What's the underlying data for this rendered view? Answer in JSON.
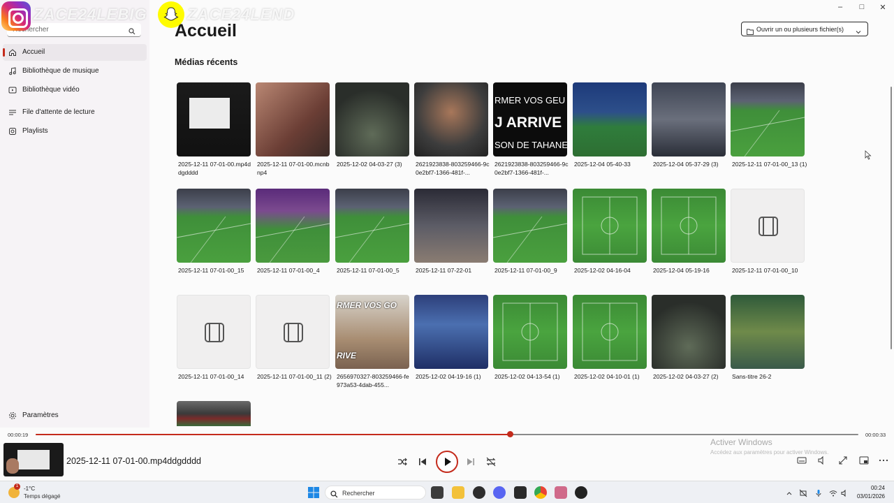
{
  "overlay": {
    "instagram_handle": "ZACE24LEBIG",
    "snapchat_handle": "ZACE24LEND"
  },
  "sidebar": {
    "search_placeholder": "Rechercher",
    "items": [
      {
        "label": "Accueil",
        "icon": "home-icon",
        "active": true
      },
      {
        "label": "Bibliothèque de musique",
        "icon": "music-note-icon"
      },
      {
        "label": "Bibliothèque vidéo",
        "icon": "video-icon"
      },
      {
        "label": "File d'attente de lecture",
        "icon": "queue-icon"
      },
      {
        "label": "Playlists",
        "icon": "playlist-icon"
      }
    ],
    "settings_label": "Paramètres"
  },
  "header": {
    "title": "Accueil",
    "open_button_label": "Ouvrir un ou plusieurs fichier(s)"
  },
  "recent": {
    "title": "Médias récents",
    "items": [
      {
        "caption": "2025-12-11 07-01-00.mp4ddgdddd",
        "thumb": "screen"
      },
      {
        "caption": "2025-12-11 07-01-00.mcnbnp4",
        "thumb": "faces"
      },
      {
        "caption": "2025-12-02 04-03-27 (3)",
        "thumb": "dark"
      },
      {
        "caption": "2621923838-803259466-9c0e2bf7-1366-481f-...",
        "thumb": "person"
      },
      {
        "caption": "2621923838-803259466-9c0e2bf7-1366-481f-...",
        "thumb": "text",
        "thumb_text": [
          "RMER VOS GEU",
          "J ARRIVE",
          "SON DE TAHANE"
        ]
      },
      {
        "caption": "2025-12-04 05-40-33",
        "thumb": "stadium"
      },
      {
        "caption": "2025-12-04 05-37-29 (3)",
        "thumb": "crowd"
      },
      {
        "caption": "2025-12-11 07-01-00_13 (1)",
        "thumb": "pitch"
      },
      {
        "caption": "2025-12-11 07-01-00_15",
        "thumb": "pitch"
      },
      {
        "caption": "2025-12-11 07-01-00_4",
        "thumb": "player"
      },
      {
        "caption": "2025-12-11 07-01-00_5",
        "thumb": "pitch"
      },
      {
        "caption": "2025-12-11 07-22-01",
        "thumb": "coach"
      },
      {
        "caption": "2025-12-11 07-01-00_9",
        "thumb": "pitch"
      },
      {
        "caption": "2025-12-02 04-16-04",
        "thumb": "pitch-top"
      },
      {
        "caption": "2025-12-04 05-19-16",
        "thumb": "pitch-top"
      },
      {
        "caption": "2025-12-11 07-01-00_10",
        "thumb": "placeholder"
      },
      {
        "caption": "2025-12-11 07-01-00_14",
        "thumb": "placeholder"
      },
      {
        "caption": "2025-12-11 07-01-00_11 (2)",
        "thumb": "placeholder"
      },
      {
        "caption": "2656970327-803259466-fe973a53-4dab-455...",
        "thumb": "boy",
        "thumb_text": [
          "RMER VOS GO",
          "RIVE"
        ]
      },
      {
        "caption": "2025-12-02 04-19-16 (1)",
        "thumb": "players"
      },
      {
        "caption": "2025-12-02 04-13-54 (1)",
        "thumb": "pitch-top"
      },
      {
        "caption": "2025-12-02 04-10-01 (1)",
        "thumb": "pitch-top"
      },
      {
        "caption": "2025-12-02 04-03-27 (2)",
        "thumb": "dark"
      },
      {
        "caption": "Sans-titre 26-2",
        "thumb": "game"
      },
      {
        "caption": "",
        "thumb": "partial"
      }
    ]
  },
  "player": {
    "elapsed": "00:00:19",
    "duration": "00:00:33",
    "progress": 0.576,
    "now_playing": "2025-12-11 07-01-00.mp4ddgdddd",
    "watermark_title": "Activer Windows",
    "watermark_sub": "Accédez aux paramètres pour activer Windows."
  },
  "taskbar": {
    "weather_badge": "1",
    "temperature": "-1°C",
    "weather": "Temps dégagé",
    "search_label": "Rechercher",
    "time": "00:24",
    "date": "03/01/2026"
  },
  "colors": {
    "accent": "#c42b1c",
    "sidebar_bg": "#f6f3f6",
    "placeholder_tile": "#f0efef"
  }
}
